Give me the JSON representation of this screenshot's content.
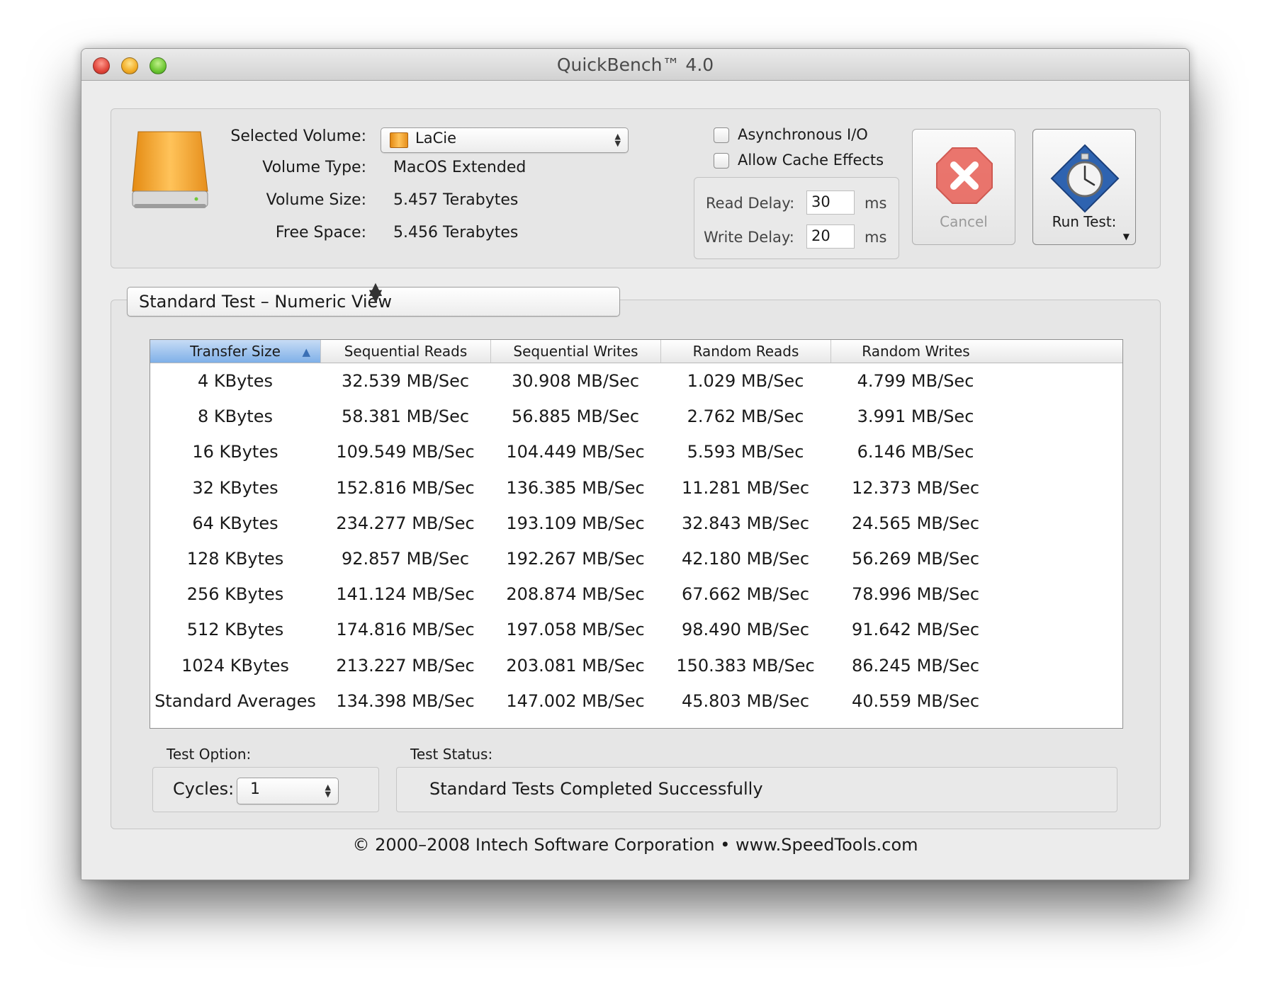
{
  "window": {
    "title": "QuickBench™ 4.0"
  },
  "volume": {
    "selected_label": "Selected Volume:",
    "selected_value": "LaCie",
    "type_label": "Volume Type:",
    "type_value": "MacOS Extended",
    "size_label": "Volume Size:",
    "size_value": "5.457 Terabytes",
    "free_label": "Free Space:",
    "free_value": "5.456 Terabytes"
  },
  "options": {
    "async_label": "Asynchronous I/O",
    "async_checked": false,
    "cache_label": "Allow Cache Effects",
    "cache_checked": false,
    "read_delay_label": "Read Delay:",
    "read_delay_value": "30",
    "write_delay_label": "Write Delay:",
    "write_delay_value": "20",
    "unit": "ms"
  },
  "buttons": {
    "cancel": "Cancel",
    "run": "Run Test:"
  },
  "view_select": "Standard Test – Numeric View",
  "table": {
    "headers": [
      "Transfer Size",
      "Sequential Reads",
      "Sequential Writes",
      "Random Reads",
      "Random Writes"
    ],
    "rows": [
      [
        "4 KBytes",
        "32.539 MB/Sec",
        "30.908 MB/Sec",
        "1.029 MB/Sec",
        "4.799 MB/Sec"
      ],
      [
        "8 KBytes",
        "58.381 MB/Sec",
        "56.885 MB/Sec",
        "2.762 MB/Sec",
        "3.991 MB/Sec"
      ],
      [
        "16 KBytes",
        "109.549 MB/Sec",
        "104.449 MB/Sec",
        "5.593 MB/Sec",
        "6.146 MB/Sec"
      ],
      [
        "32 KBytes",
        "152.816 MB/Sec",
        "136.385 MB/Sec",
        "11.281 MB/Sec",
        "12.373 MB/Sec"
      ],
      [
        "64 KBytes",
        "234.277 MB/Sec",
        "193.109 MB/Sec",
        "32.843 MB/Sec",
        "24.565 MB/Sec"
      ],
      [
        "128 KBytes",
        "92.857 MB/Sec",
        "192.267 MB/Sec",
        "42.180 MB/Sec",
        "56.269 MB/Sec"
      ],
      [
        "256 KBytes",
        "141.124 MB/Sec",
        "208.874 MB/Sec",
        "67.662 MB/Sec",
        "78.996 MB/Sec"
      ],
      [
        "512 KBytes",
        "174.816 MB/Sec",
        "197.058 MB/Sec",
        "98.490 MB/Sec",
        "91.642 MB/Sec"
      ],
      [
        "1024 KBytes",
        "213.227 MB/Sec",
        "203.081 MB/Sec",
        "150.383 MB/Sec",
        "86.245 MB/Sec"
      ],
      [
        "Standard Averages",
        "134.398 MB/Sec",
        "147.002 MB/Sec",
        "45.803 MB/Sec",
        "40.559 MB/Sec"
      ]
    ]
  },
  "test_option": {
    "label": "Test Option:",
    "cycles_label": "Cycles:",
    "cycles_value": "1"
  },
  "test_status": {
    "label": "Test Status:",
    "value": "Standard Tests Completed Successfully"
  },
  "footer": "© 2000–2008 Intech Software Corporation • www.SpeedTools.com",
  "colors": {
    "drive": "#f0a030",
    "cancel": "#e0453a",
    "sort_header": "#7fb0e8"
  }
}
